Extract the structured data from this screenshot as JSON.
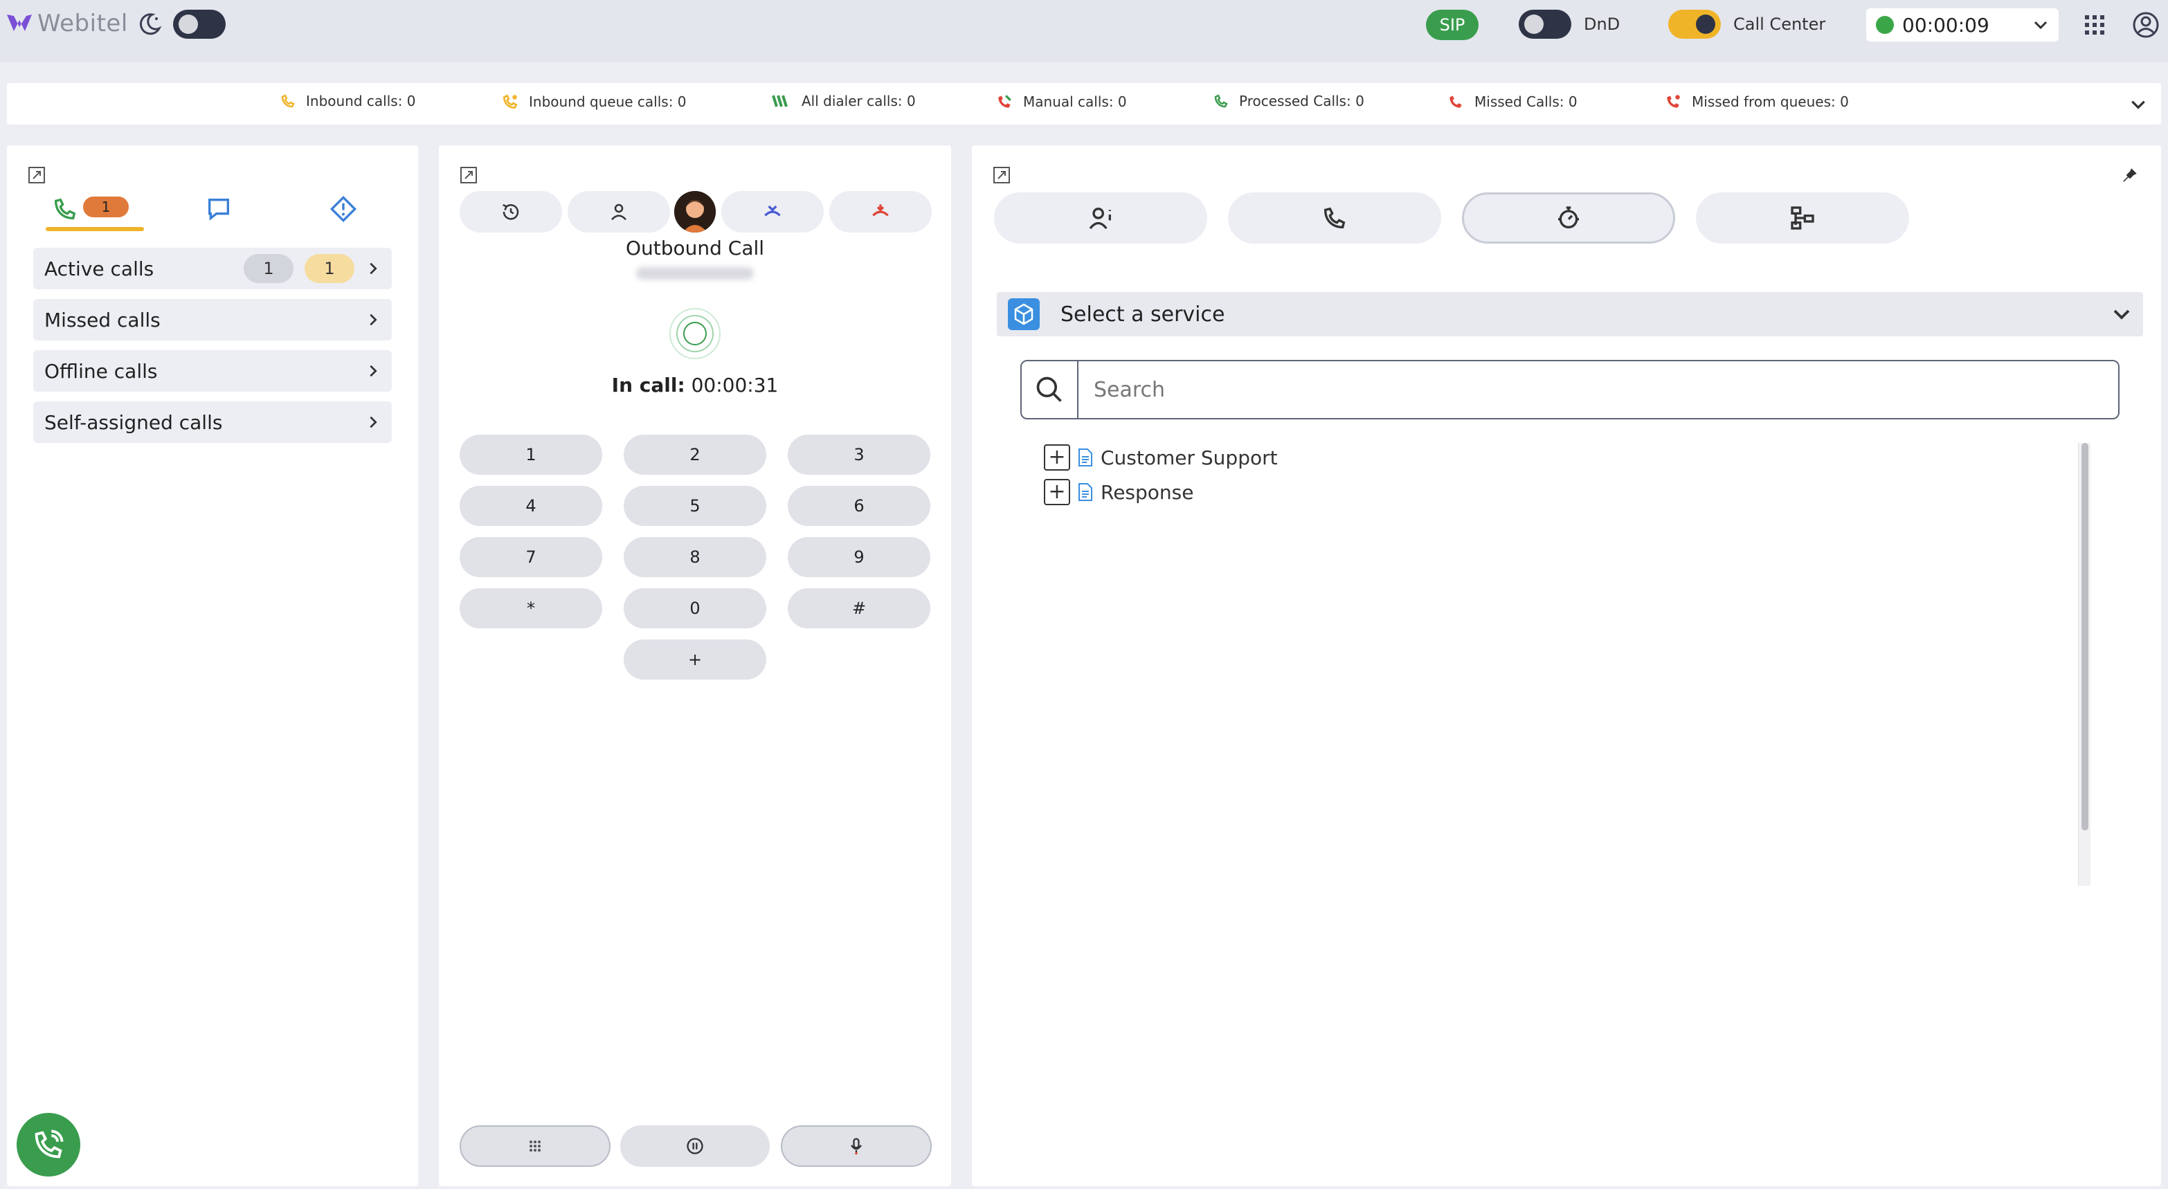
{
  "app": {
    "logo_text": "Webitel"
  },
  "topbar": {
    "sip_label": "SIP",
    "dnd_label": "DnD",
    "call_center_label": "Call Center",
    "status_timer": "00:00:09",
    "status_color": "#3ba647"
  },
  "stats": [
    {
      "label": "Inbound calls: 0",
      "icon": "inbound-call-icon"
    },
    {
      "label": "Inbound queue calls: 0",
      "icon": "inbound-queue-icon"
    },
    {
      "label": "All dialer calls: 0",
      "icon": "dialer-icon"
    },
    {
      "label": "Manual calls: 0",
      "icon": "manual-call-icon"
    },
    {
      "label": "Processed Calls: 0",
      "icon": "processed-call-icon"
    },
    {
      "label": "Missed Calls: 0",
      "icon": "missed-call-icon"
    },
    {
      "label": "Missed from queues: 0",
      "icon": "missed-queue-icon"
    }
  ],
  "left_panel": {
    "calls_tab_badge": "1",
    "items": [
      {
        "label": "Active calls",
        "count_a": "1",
        "count_b": "1"
      },
      {
        "label": "Missed calls"
      },
      {
        "label": "Offline calls"
      },
      {
        "label": "Self-assigned calls"
      }
    ]
  },
  "call": {
    "title": "Outbound Call",
    "in_call_label": "In call:",
    "duration": "00:00:31"
  },
  "keypad": [
    "1",
    "2",
    "3",
    "4",
    "5",
    "6",
    "7",
    "8",
    "9",
    "*",
    "0",
    "#",
    "+"
  ],
  "right_panel": {
    "service_select_label": "Select a service",
    "search_placeholder": "Search",
    "tree": [
      {
        "label": "Customer Support"
      },
      {
        "label": "Response"
      }
    ]
  },
  "colors": {
    "accent_yellow": "#f0b429",
    "green": "#3a9d4e",
    "badge_orange": "#e07a3a"
  }
}
